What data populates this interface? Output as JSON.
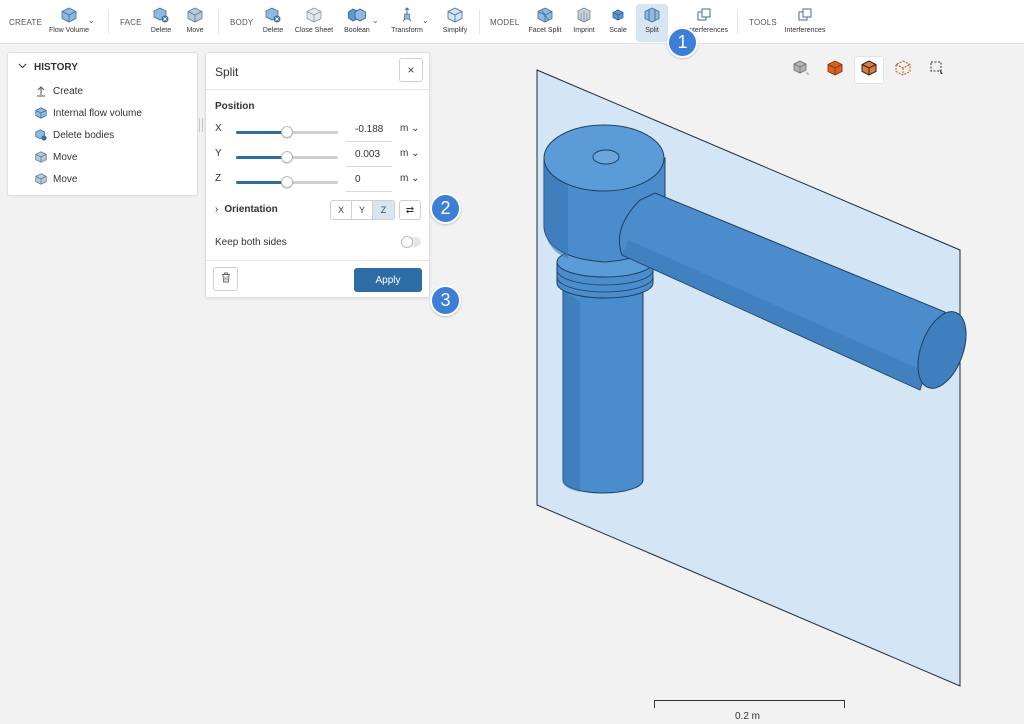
{
  "toolbar": {
    "groups": {
      "create": "CREATE",
      "face": "FACE",
      "body": "BODY",
      "model": "MODEL",
      "tools": "TOOLS"
    },
    "buttons": {
      "flow_volume": "Flow Volume",
      "face_delete": "Delete",
      "face_move": "Move",
      "body_delete": "Delete",
      "close_sheet": "Close Sheet",
      "boolean": "Boolean",
      "transform": "Transform",
      "simplify": "Simplify",
      "facet_split": "Facet Split",
      "imprint": "Imprint",
      "scale": "Scale",
      "split": "Split",
      "interferences_partial": "nterferences",
      "interferences": "Interferences"
    }
  },
  "history": {
    "title": "HISTORY",
    "items": [
      {
        "label": "Create",
        "icon": "upload-arrow-icon"
      },
      {
        "label": "Internal flow volume",
        "icon": "cube-icon"
      },
      {
        "label": "Delete bodies",
        "icon": "cube-delete-icon"
      },
      {
        "label": "Move",
        "icon": "cube-icon"
      },
      {
        "label": "Move",
        "icon": "cube-icon"
      }
    ]
  },
  "split": {
    "title": "Split",
    "close": "×",
    "position_label": "Position",
    "axes": [
      {
        "label": "X",
        "value": "-0.188",
        "unit": "m",
        "slider_fraction": 0.5
      },
      {
        "label": "Y",
        "value": "0.003",
        "unit": "m",
        "slider_fraction": 0.5
      },
      {
        "label": "Z",
        "value": "0",
        "unit": "m",
        "slider_fraction": 0.5
      }
    ],
    "orientation_label": "Orientation",
    "orientation_options": [
      "X",
      "Y",
      "Z"
    ],
    "orientation_selected": "Z",
    "swap": "⇄",
    "keep_both_sides": "Keep both sides",
    "keep_both_sides_on": false,
    "apply": "Apply"
  },
  "badges": [
    "1",
    "2",
    "3"
  ],
  "scale_bar": "0.2 m",
  "colors": {
    "accent": "#2e6da4",
    "badge": "#3d7ed6",
    "model": "#4a8ccc",
    "plane": "#cfe3f7",
    "cube_orange": "#d9631e"
  }
}
